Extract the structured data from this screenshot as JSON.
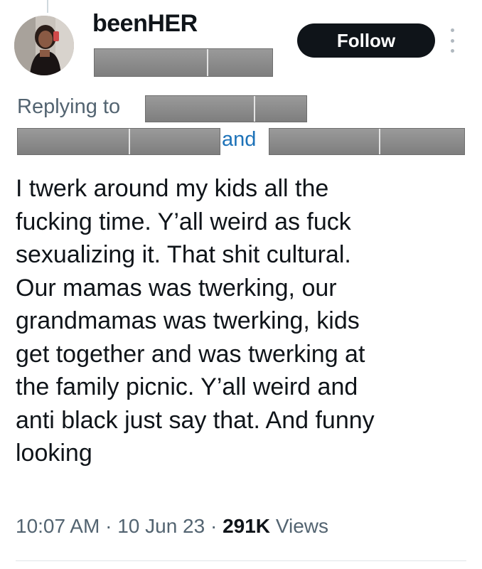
{
  "post": {
    "author": {
      "display_name": "beenHER"
    },
    "follow_label": "Follow",
    "replying_to_label": "Replying to",
    "and_label": "and",
    "lines": [
      "I twerk around my kids all the",
      "fucking time. Y’all weird as fuck",
      "sexualizing it. That shit cultural.",
      "Our mamas was twerking, our",
      "grandmamas was twerking, kids",
      "get together and was twerking at",
      "the family picnic. Y’all weird and",
      "anti black just say that. And funny",
      "looking"
    ],
    "time": "10:07 AM",
    "separator": "·",
    "date": "10 Jun 23",
    "views_count": "291K",
    "views_label": "Views"
  },
  "colors": {
    "text_primary": "#0f1419",
    "text_secondary": "#536471",
    "mention_link": "#1d72b8",
    "follow_button_bg": "#0f1419",
    "redaction": "#8a8a8a"
  },
  "icons": {
    "more": "more-vertical-icon"
  }
}
